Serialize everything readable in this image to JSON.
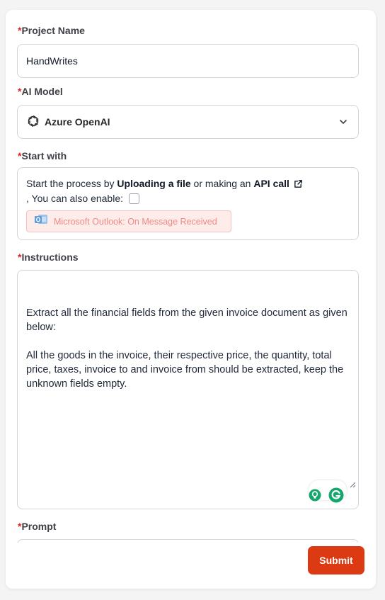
{
  "form": {
    "required_mark": "*",
    "project_name": {
      "label": "Project Name",
      "value": "HandWrites"
    },
    "ai_model": {
      "label": "AI Model",
      "value": "Azure OpenAI",
      "icon": "openai-logo-icon"
    },
    "start_with": {
      "label": "Start with",
      "text_before": "Start the process by ",
      "upload_link": "Uploading a file",
      "text_middle": " or making an ",
      "api_link": "API call",
      "enable_text": ", You can also enable:",
      "outlook_trigger": "Microsoft Outlook: On Message Received",
      "outlook_checked": false
    },
    "instructions": {
      "label": "Instructions",
      "value": "Extract all the financial fields from the given invoice document as given below:\n\nAll the goods in the invoice, their respective price, the quantity, total price, taxes, invoice to and invoice from should be extracted, keep the unknown fields empty."
    },
    "prompt": {
      "label": "Prompt",
      "value": ""
    },
    "submit_label": "Submit"
  },
  "colors": {
    "accent": "#dc3a12",
    "required": "#dc2626",
    "outlook_chip_bg": "#fdecea",
    "outlook_chip_text": "#ef8a84",
    "grammarly_green": "#15a66e"
  }
}
